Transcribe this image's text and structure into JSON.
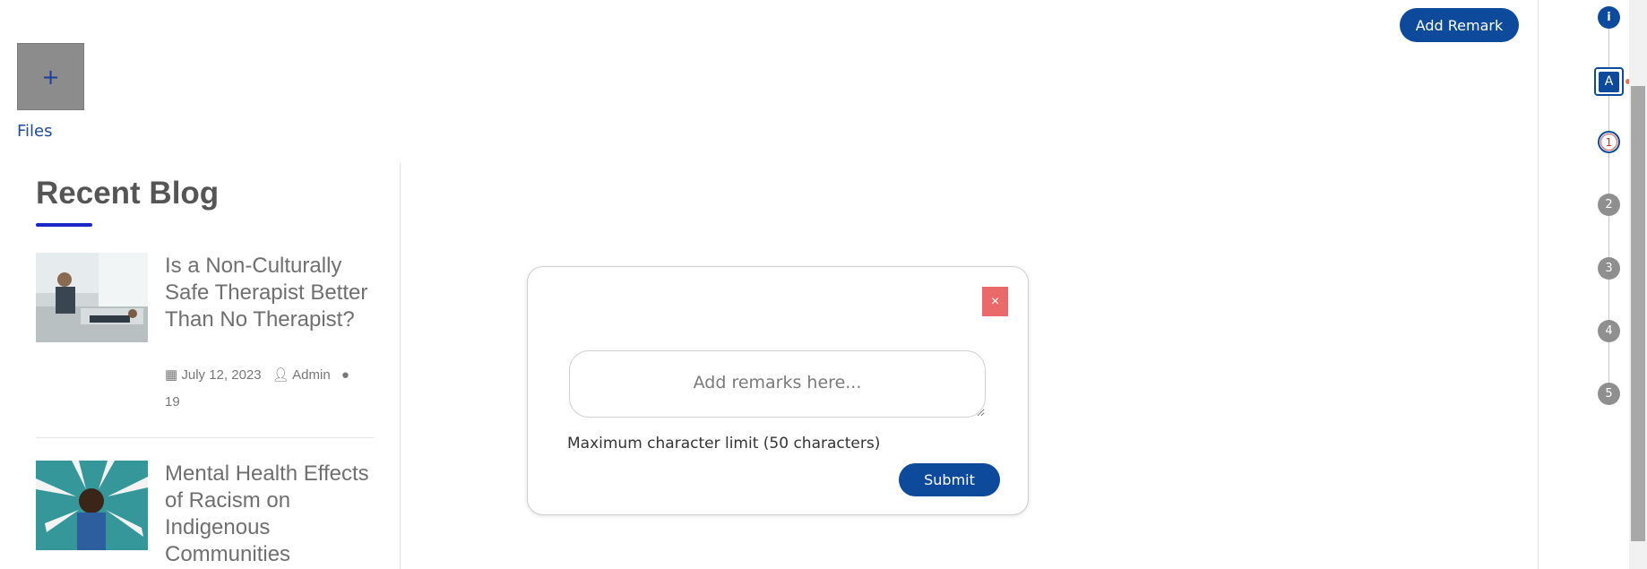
{
  "header": {
    "add_remark_label": "Add Remark"
  },
  "files": {
    "plus_glyph": "+",
    "label": "Files"
  },
  "blog": {
    "title": "Recent Blog",
    "posts": [
      {
        "title": "Is a Non-Culturally Safe Therapist Better Than No Therapist?",
        "date": "July 12, 2023",
        "author": "Admin",
        "comments": "19"
      },
      {
        "title": "Mental Health Effects of Racism on Indigenous Communities"
      }
    ]
  },
  "modal": {
    "close_glyph": "×",
    "remarks_placeholder": "Add remarks here...",
    "limit_text": "Maximum character limit (50 characters)",
    "submit_label": "Submit"
  },
  "stepper": {
    "info_label": "i",
    "a_label": "A",
    "steps": [
      "1",
      "2",
      "3",
      "4",
      "5"
    ]
  },
  "colors": {
    "primary": "#0d4a9b",
    "close": "#ea6a6a",
    "accent_underline": "#1b26c9"
  }
}
